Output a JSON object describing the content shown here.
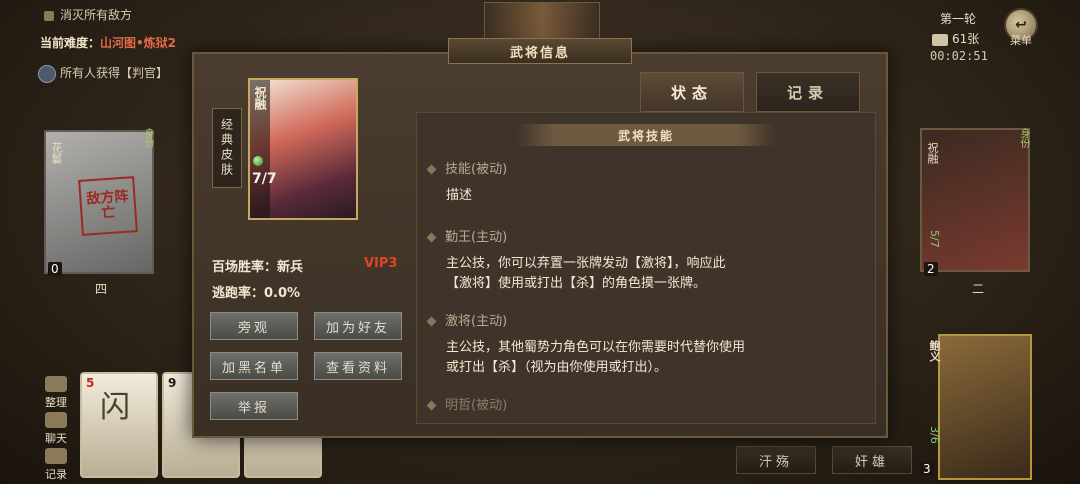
{
  "top_left": {
    "objective": "消灭所有敌方",
    "difficulty_label": "当前难度：",
    "difficulty_value": "山河图•炼狱2",
    "reward": "所有人获得【判官】"
  },
  "top_right": {
    "round": "第一轮",
    "deck_count": "61张",
    "timer": "00:02:51",
    "return_label": "菜单"
  },
  "seats": {
    "left": {
      "name": "花鬘",
      "status_stamp": "敌方阵亡",
      "hp": "0",
      "seat_number": "四",
      "role": "身份"
    },
    "right": {
      "name": "祝融",
      "hp": "2",
      "hp_ratio": "5/7",
      "seat_number": "二",
      "role": "身份"
    },
    "self": {
      "name": "鲍义",
      "hp": "3",
      "hp_ratio": "3/6"
    }
  },
  "hand": {
    "side_buttons": [
      "整理",
      "聊天",
      "记录"
    ],
    "cards": [
      {
        "rank": "5",
        "suit": "♦",
        "suit_color": "#c0281c",
        "name": "闪"
      },
      {
        "rank": "9",
        "suit": "♠",
        "suit_color": "#1a1a1a",
        "name": ""
      },
      {
        "rank": "",
        "suit": "",
        "suit_color": "#1a1a1a",
        "name": ""
      }
    ],
    "bottom_buttons": [
      "汗殇",
      "奸雄"
    ]
  },
  "modal": {
    "title": "武将信息",
    "skin_tag": "经典皮肤",
    "hero_name": "祝融",
    "hero_hp": "7/7",
    "win_rate_label": "百场胜率：新兵",
    "vip": "VIP3",
    "escape_rate": "逃跑率：0.0%",
    "buttons": {
      "spectate": "旁观",
      "add_friend": "加为好友",
      "blacklist": "加黑名单",
      "view_profile": "查看资料",
      "report": "举报"
    },
    "tabs": {
      "status": "状态",
      "record": "记录"
    },
    "skills_header": "武将技能",
    "skills": [
      {
        "title": "技能(被动)",
        "desc": "描述"
      },
      {
        "title": "勤王(主动)",
        "desc_line1": "主公技，你可以弃置一张牌发动【激将】，响应此",
        "desc_line2": "【激将】使用或打出【杀】的角色摸一张牌。"
      },
      {
        "title": "激将(主动)",
        "desc_line1": "主公技，其他蜀势力角色可以在你需要时代替你使用",
        "desc_line2": "或打出【杀】（视为由你使用或打出）。"
      },
      {
        "title": "明哲(被动)"
      }
    ]
  }
}
